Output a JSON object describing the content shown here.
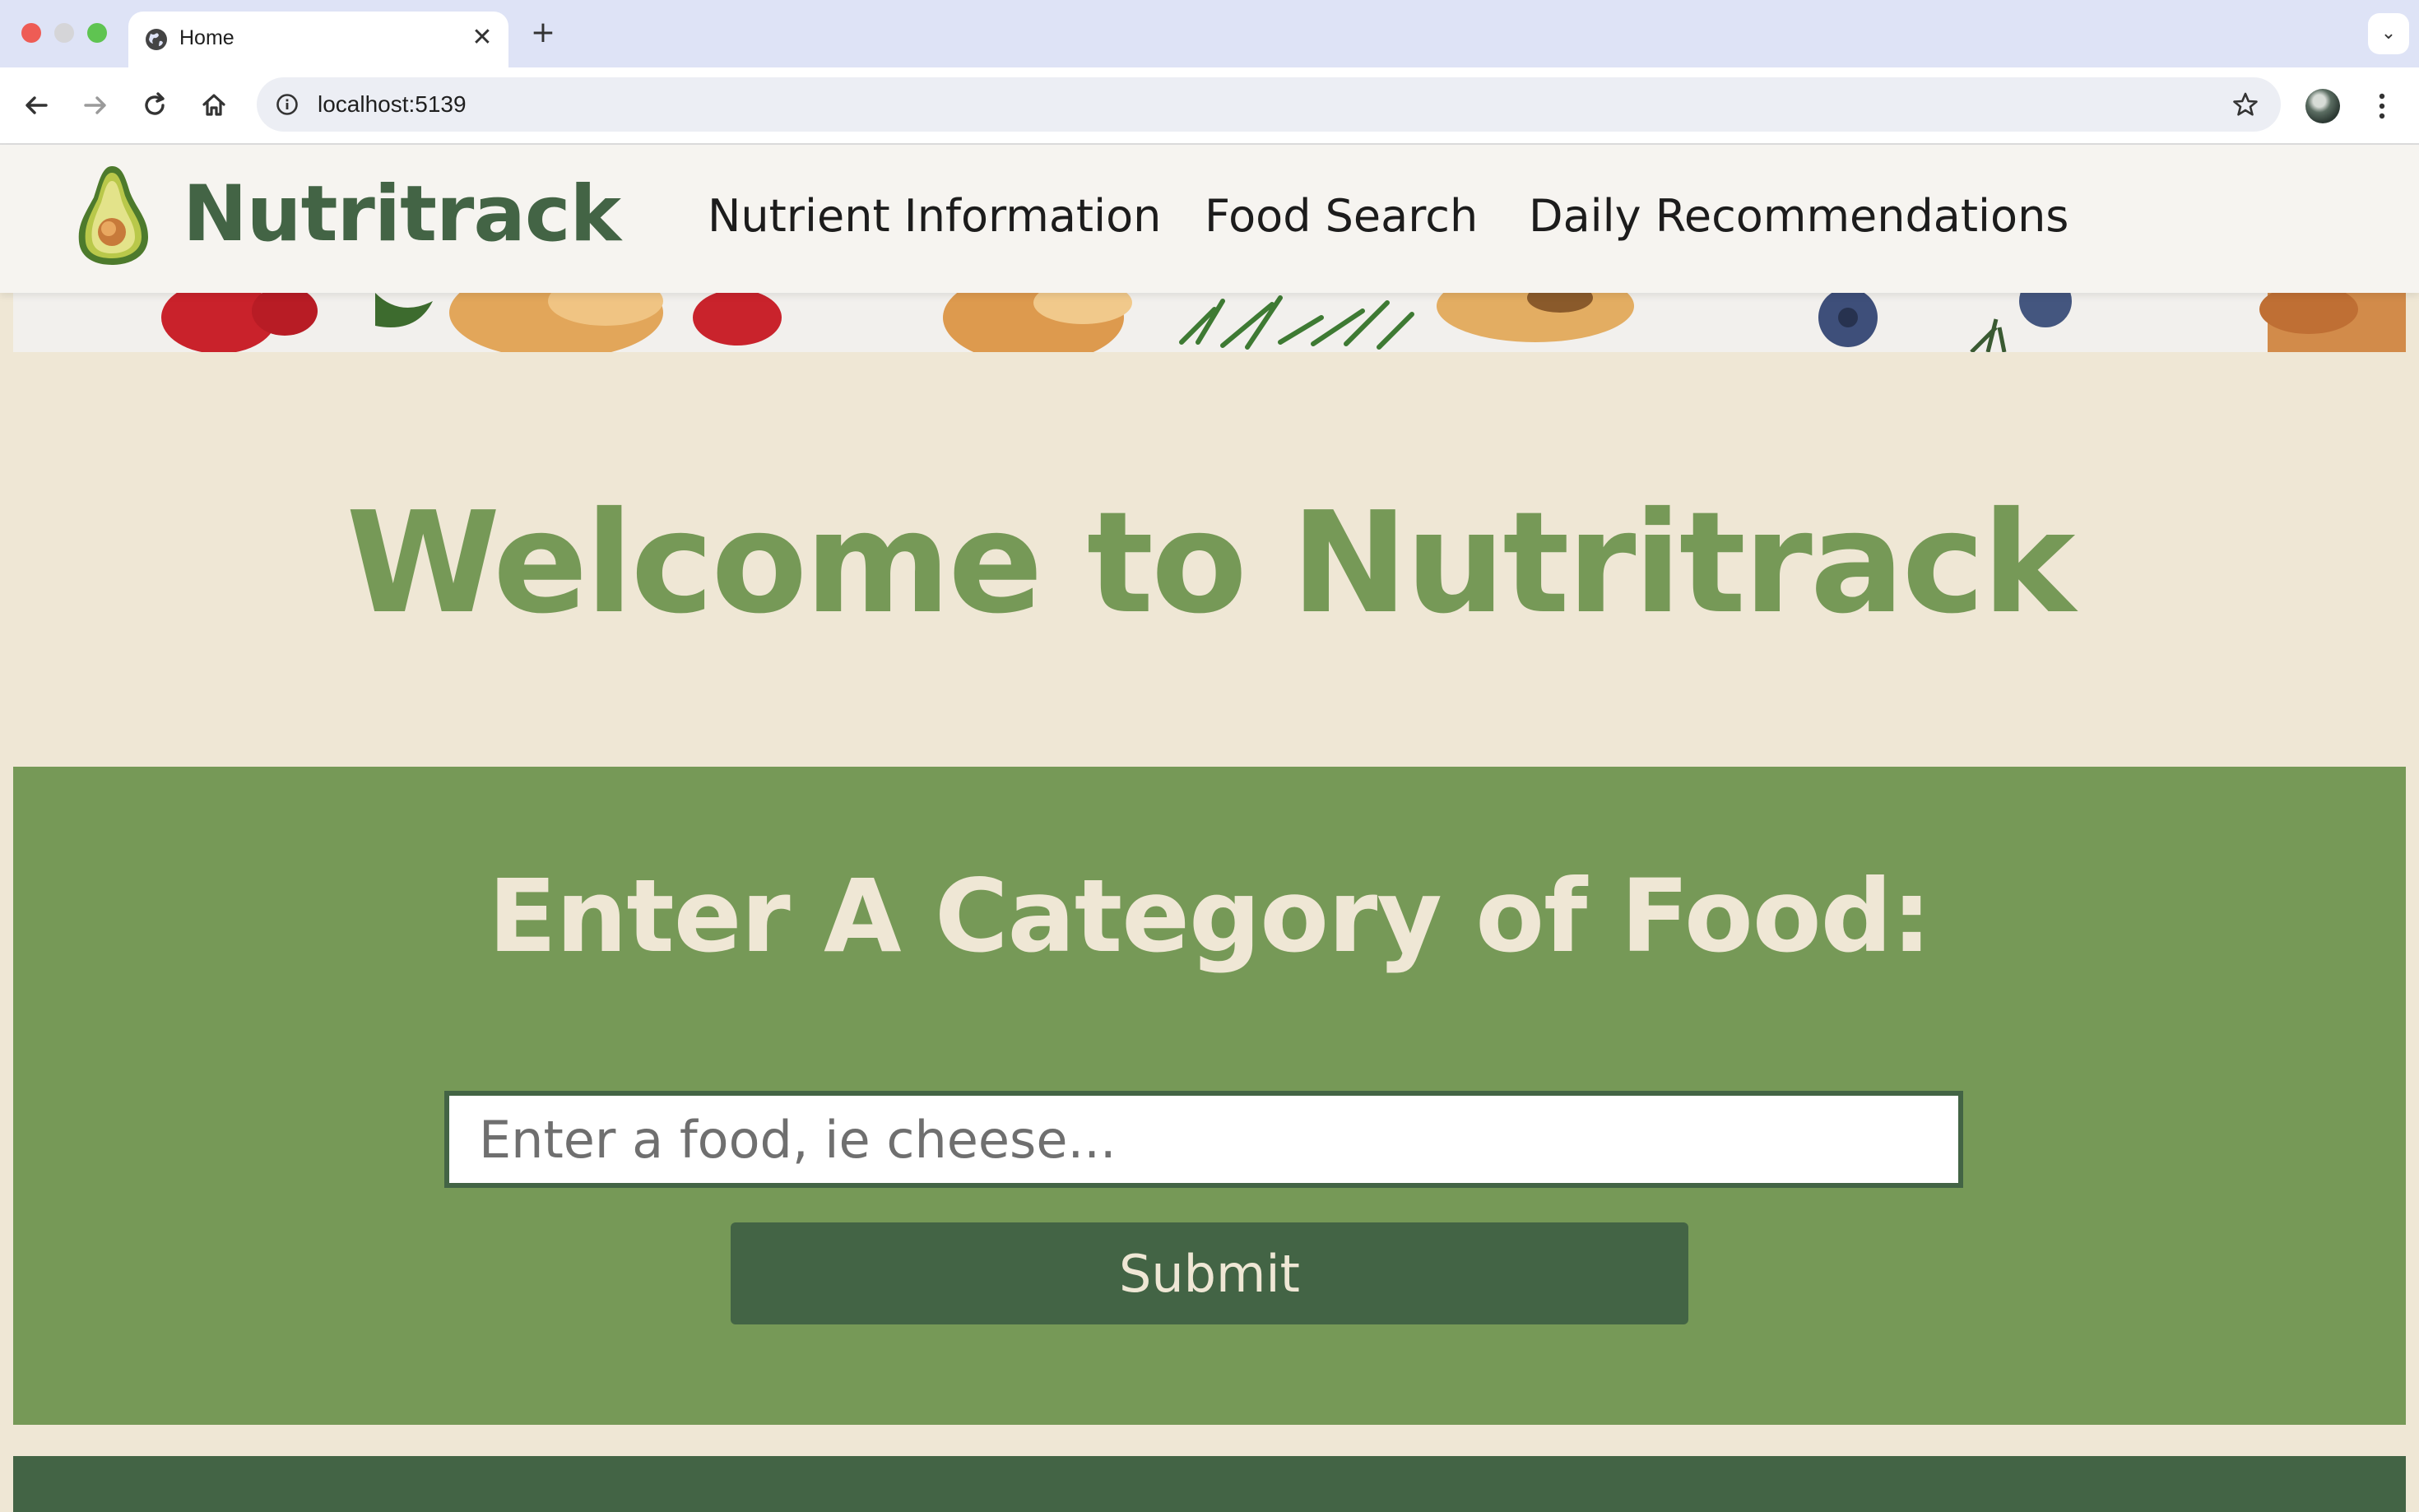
{
  "browser": {
    "tab_title": "Home",
    "tab_close": "✕",
    "new_tab": "+",
    "tab_menu": "⌄",
    "url": "localhost:5139"
  },
  "site": {
    "brand": "Nutritrack",
    "nav": [
      {
        "label": "Nutrient Information"
      },
      {
        "label": "Food Search"
      },
      {
        "label": "Daily Recommendations"
      }
    ]
  },
  "main": {
    "welcome": "Welcome to Nutritrack",
    "search": {
      "title": "Enter A Category of Food:",
      "placeholder": "Enter a food, ie cheese...",
      "value": "",
      "submit_label": "Submit"
    }
  },
  "colors": {
    "brand_dark_green": "#436445",
    "brand_green": "#769957",
    "cream": "#efe7d5",
    "header_bg": "#f6f4f0"
  },
  "icons": {
    "tab_favicon": "globe-icon",
    "back": "arrow-left-icon",
    "forward": "arrow-right-icon",
    "reload": "reload-icon",
    "home": "home-icon",
    "site_info": "info-icon",
    "bookmark": "star-icon",
    "menu": "kebab-menu-icon",
    "logo": "avocado-icon"
  }
}
